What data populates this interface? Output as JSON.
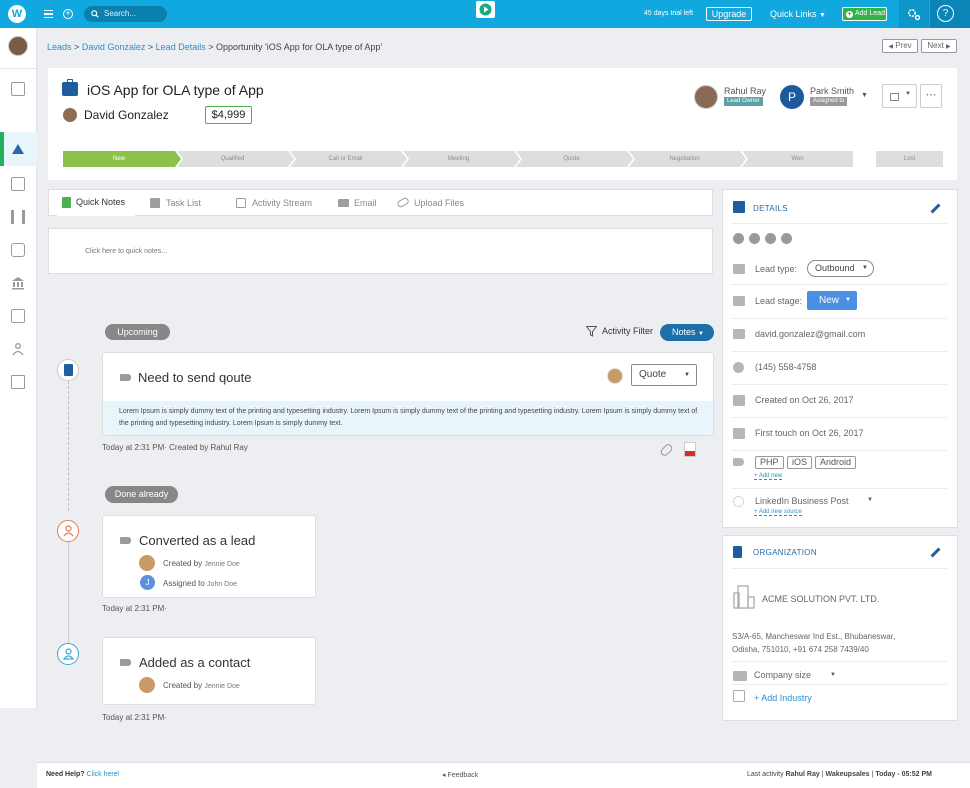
{
  "topbar": {
    "logo": "W",
    "search_placeholder": "Search...",
    "trial_text": "45 days trial left",
    "upgrade_label": "Upgrade",
    "quick_links_label": "Quick Links",
    "add_lead_label": "Add Lead",
    "help_label": "?",
    "accent_color": "#11a7df"
  },
  "breadcrumb": {
    "items": [
      "Leads",
      "David Gonzalez",
      "Lead Details"
    ],
    "current": "Opportunity 'iOS App for OLA type of App'",
    "separator": ">",
    "prev_label": "Prev",
    "next_label": "Next"
  },
  "header": {
    "title": "iOS App for OLA type of App",
    "contact_name": "David Gonzalez",
    "amount": "$4,999",
    "owner_name": "Rahul Ray",
    "owner_badge": "Lead Owner",
    "assignee_initial": "P",
    "assignee_name": "Park Smith",
    "assignee_badge": "Assigned to"
  },
  "pipeline": {
    "stages": [
      "New",
      "Qualified",
      "Call or Email",
      "Meeting",
      "Quote",
      "Negotiation",
      "Won"
    ],
    "active_stage": "New",
    "lost_label": "Lost",
    "active_color": "#8bc34a"
  },
  "tabs": [
    {
      "label": "Quick Notes",
      "icon": "note-icon"
    },
    {
      "label": "Task List",
      "icon": "list-icon"
    },
    {
      "label": "Activity Stream",
      "icon": "calendar-icon"
    },
    {
      "label": "Email",
      "icon": "mail-icon"
    },
    {
      "label": "Upload Files",
      "icon": "paperclip-icon"
    }
  ],
  "quick_notes_placeholder": "Click here to quick notes...",
  "activity": {
    "upcoming_label": "Upcoming",
    "filter_label": "Activity Filter",
    "filter_value": "Notes",
    "done_label": "Done already",
    "upcoming_item": {
      "title": "Need to send qoute",
      "select_value": "Quote",
      "body": "Lorem Ipsum is simply dummy text of the printing and typesetting industry. Lorem Ipsum is simply dummy text of the printing and typesetting industry. Lorem Ipsum is simply dummy text of the printing and typesetting industry. Lorem Ipsum is simply dummy text.",
      "meta": "Today at 2:31 PM· Created by Rahul Ray"
    },
    "done_items": [
      {
        "title": "Converted as a lead",
        "created_label": "Created by",
        "created_by": "Jennie Doe",
        "assigned_label": "Assigned to",
        "assigned_to": "John Doe",
        "assigned_initial": "J",
        "meta": "Today at 2:31 PM·"
      },
      {
        "title": "Added as a contact",
        "created_label": "Created by",
        "created_by": "Jennie Doe",
        "meta": "Today at 2:31 PM·"
      }
    ]
  },
  "details": {
    "title": "DETAILS",
    "lead_type_label": "Lead type:",
    "lead_type_value": "Outbound",
    "lead_stage_label": "Lead stage:",
    "lead_stage_value": "New",
    "email": "david.gonzalez@gmail.com",
    "phone": "(145) 558-4758",
    "created_on": "Created on Oct 26, 2017",
    "first_touch": "First touch on Oct 26, 2017",
    "tags": [
      "PHP",
      "iOS",
      "Android"
    ],
    "add_new_label": "+ Add new",
    "source": "LinkedIn Business Post",
    "add_source_label": "+ Add new source"
  },
  "organization": {
    "title": "ORGANIZATION",
    "name": "ACME SOLUTION PVT. LTD.",
    "address_line1": "S3/A-65, Mancheswar Ind Est., Bhubaneswar,",
    "address_line2": "Odisha, 751010, +91 674 258 7439/40",
    "company_size_label": "Company size",
    "add_industry_label": "+ Add Industry"
  },
  "footer": {
    "help_text": "Need Help?",
    "help_link": "Click here!",
    "feedback_label": "Feedback",
    "last_activity_label": "Last activity",
    "last_activity_user": "Rahul Ray",
    "app_name": "Wakeupsales",
    "time": "Today - 05:52 PM"
  }
}
